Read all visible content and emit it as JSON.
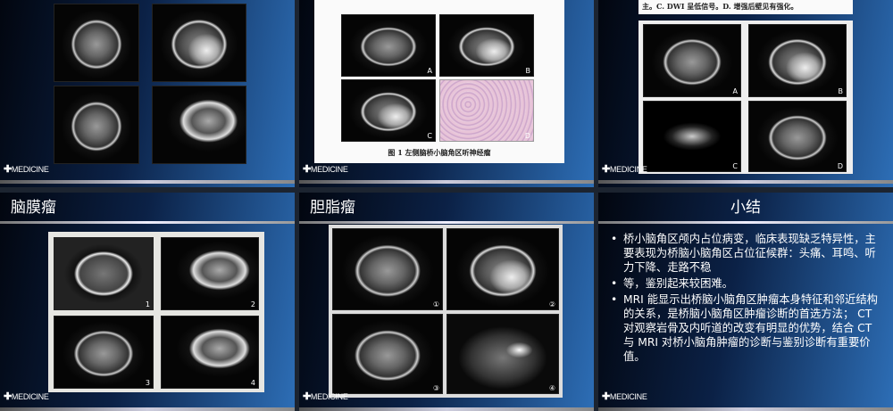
{
  "footer_brand": "MEDICINE",
  "slides": [
    {
      "title": ""
    },
    {
      "caption": "图 1  左侧脑桥小脑角区听神经瘤",
      "panel_labels": [
        "A",
        "B",
        "C",
        "D"
      ]
    },
    {
      "caption": "主。C. DWI 呈低信号。D. 增强后壁见有强化。",
      "panel_labels": [
        "A",
        "B",
        "C",
        "D"
      ]
    },
    {
      "title": "脑膜瘤",
      "panel_labels": [
        "1",
        "2",
        "3",
        "4"
      ]
    },
    {
      "title": "胆脂瘤",
      "panel_labels": [
        "①",
        "②",
        "③",
        "④"
      ]
    },
    {
      "title": "小结",
      "bullets": [
        "桥小脑角区颅内占位病变，临床表现缺乏特异性，主要表现为桥脑小脑角区占位征候群：头痛、耳鸣、听力下降、走路不稳",
        "等，鉴别起来较困难。",
        "MRI 能显示出桥脑小脑角区肿瘤本身特征和邻近结构的关系，是桥脑小脑角区肿瘤诊断的首选方法； CT 对观察岩骨及内听道的改变有明显的优势，结合 CT 与 MRI 对桥小脑角肿瘤的诊断与鉴别诊断有重要价值。"
      ]
    }
  ]
}
